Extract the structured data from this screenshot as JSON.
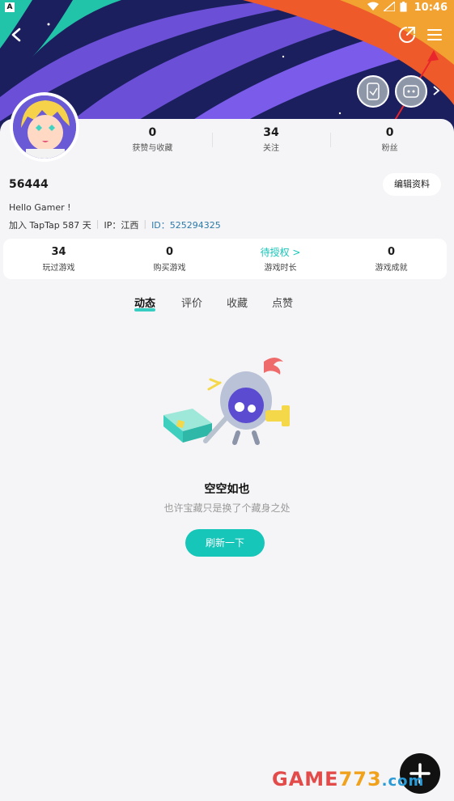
{
  "status_bar": {
    "time": "10:46",
    "app_badge": "A"
  },
  "profile": {
    "username": "56444",
    "bio": "Hello Gamer !",
    "join_text": "加入 TapTap 587 天",
    "ip_text": "IP：江西",
    "id_text": "ID：525294325",
    "edit_label": "编辑资料"
  },
  "top_stats": [
    {
      "value": "0",
      "label": "获赞与收藏"
    },
    {
      "value": "34",
      "label": "关注"
    },
    {
      "value": "0",
      "label": "粉丝"
    }
  ],
  "game_stats": [
    {
      "value": "34",
      "label": "玩过游戏"
    },
    {
      "value": "0",
      "label": "购买游戏"
    },
    {
      "value": "待授权 >",
      "label": "游戏时长"
    },
    {
      "value": "0",
      "label": "游戏成就"
    }
  ],
  "tabs": [
    "动态",
    "评价",
    "收藏",
    "点赞"
  ],
  "empty_state": {
    "title": "空空如也",
    "subtitle": "也许宝藏只是换了个藏身之处",
    "button": "刷新一下"
  },
  "watermark": {
    "part1": "GAME",
    "part2": "773",
    "part3": ".com"
  },
  "colors": {
    "accent": "#16c6b8",
    "banner": "#1b1f5e",
    "id_link": "#2b7aa8"
  },
  "icons": [
    "back-icon",
    "share-icon",
    "menu-icon",
    "badge-icon",
    "chevron-right-icon",
    "plus-icon"
  ]
}
